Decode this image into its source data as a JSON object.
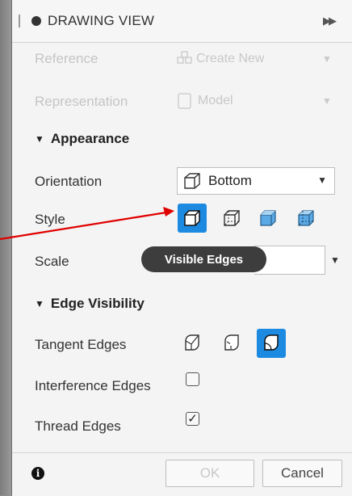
{
  "panel": {
    "title": "DRAWING VIEW"
  },
  "reference": {
    "label": "Reference",
    "value": "Create New"
  },
  "representation": {
    "label": "Representation",
    "value": "Model"
  },
  "appearance": {
    "section_label": "Appearance",
    "orientation_label": "Orientation",
    "orientation_value": "Bottom",
    "style_label": "Style",
    "style_options": [
      "visible-edges",
      "visible-and-hidden-edges",
      "shaded",
      "shaded-with-hidden-edges"
    ],
    "style_selected": "visible-edges",
    "scale_label": "Scale",
    "tooltip": "Visible Edges"
  },
  "edge_visibility": {
    "section_label": "Edge Visibility",
    "tangent_edges_label": "Tangent Edges",
    "tangent_options": [
      "full-length",
      "shortened",
      "off"
    ],
    "tangent_selected": "off",
    "interference_edges_label": "Interference Edges",
    "interference_checked": false,
    "thread_edges_label": "Thread Edges",
    "thread_checked": true
  },
  "footer": {
    "ok_label": "OK",
    "cancel_label": "Cancel"
  },
  "colors": {
    "accent": "#1c8ae0",
    "annotation_arrow": "#e00000"
  }
}
